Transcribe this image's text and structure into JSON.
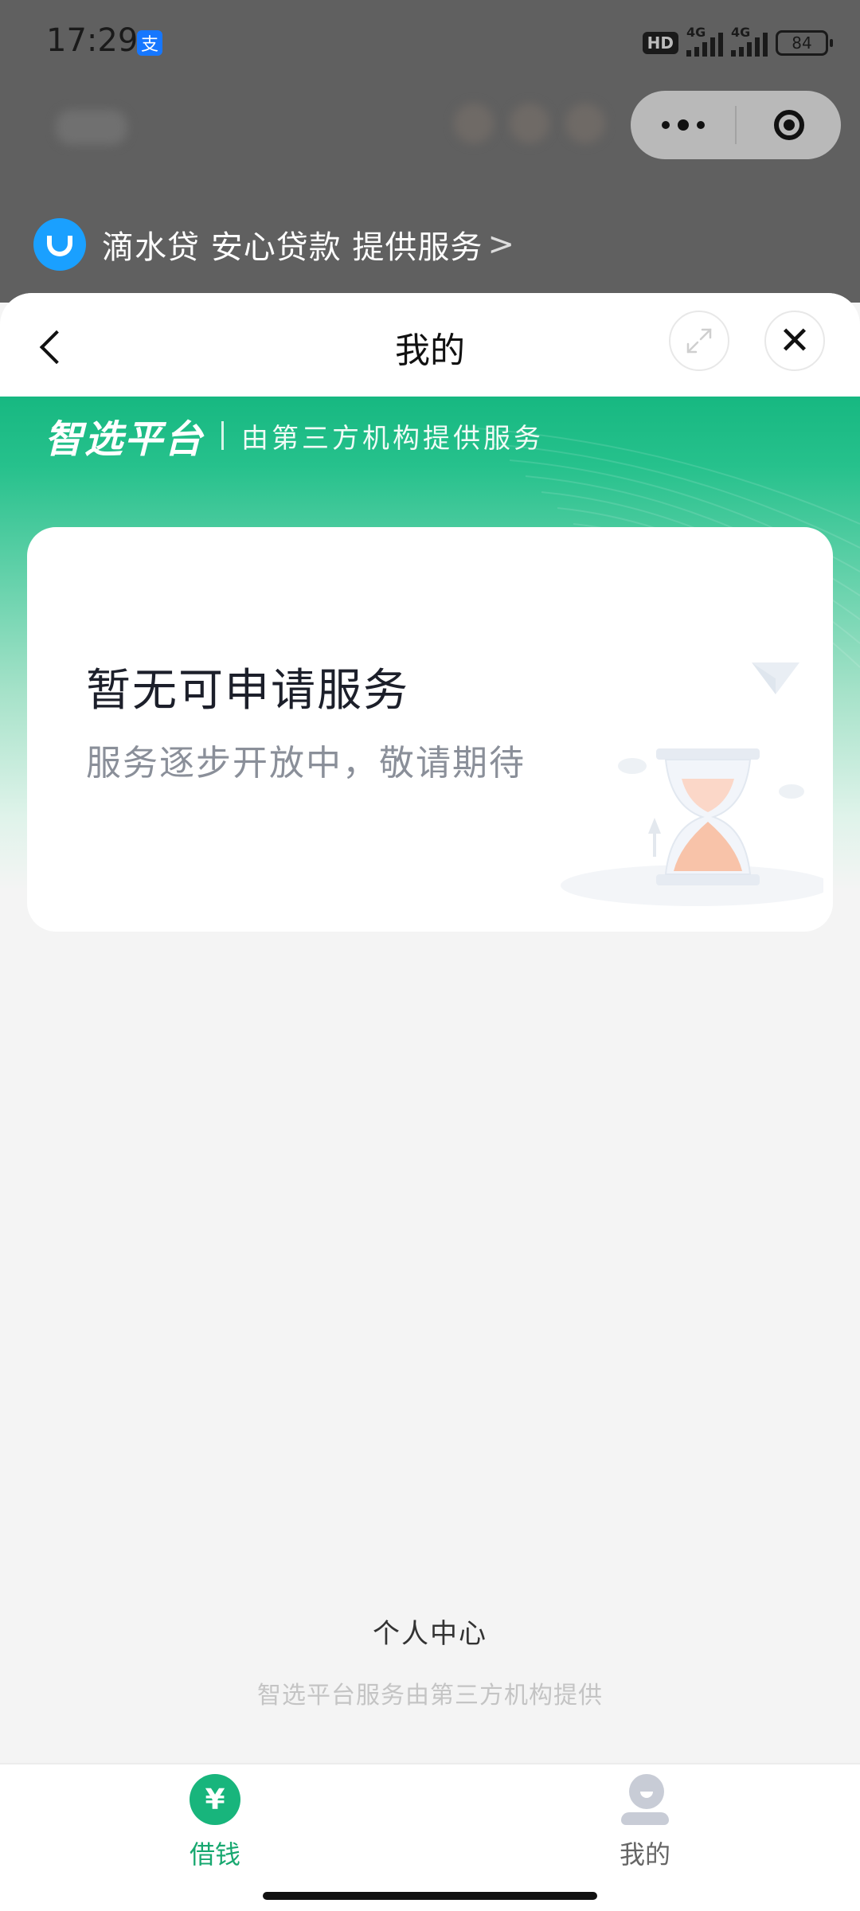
{
  "status_bar": {
    "time": "17:29",
    "alipay_badge": "支",
    "hd_label": "HD",
    "network_1": "4G",
    "network_2": "4G",
    "battery": "84"
  },
  "provider": {
    "text": "滴水贷 安心贷款 提供服务",
    "chevron": ">"
  },
  "sheet": {
    "title": "我的",
    "close_glyph": "✕"
  },
  "brand": {
    "logo": "智选平台",
    "subtitle": "由第三方机构提供服务"
  },
  "empty_card": {
    "title": "暂无可申请服务",
    "subtitle": "服务逐步开放中，敬请期待"
  },
  "footer": {
    "title": "个人中心",
    "note": "智选平台服务由第三方机构提供"
  },
  "tabs": [
    {
      "label": "借钱",
      "icon": "yuan-icon",
      "icon_glyph": "¥",
      "active": true
    },
    {
      "label": "我的",
      "icon": "user-icon",
      "active": false
    }
  ],
  "colors": {
    "accent": "#18b57c",
    "provider_logo": "#1aa0ff"
  }
}
